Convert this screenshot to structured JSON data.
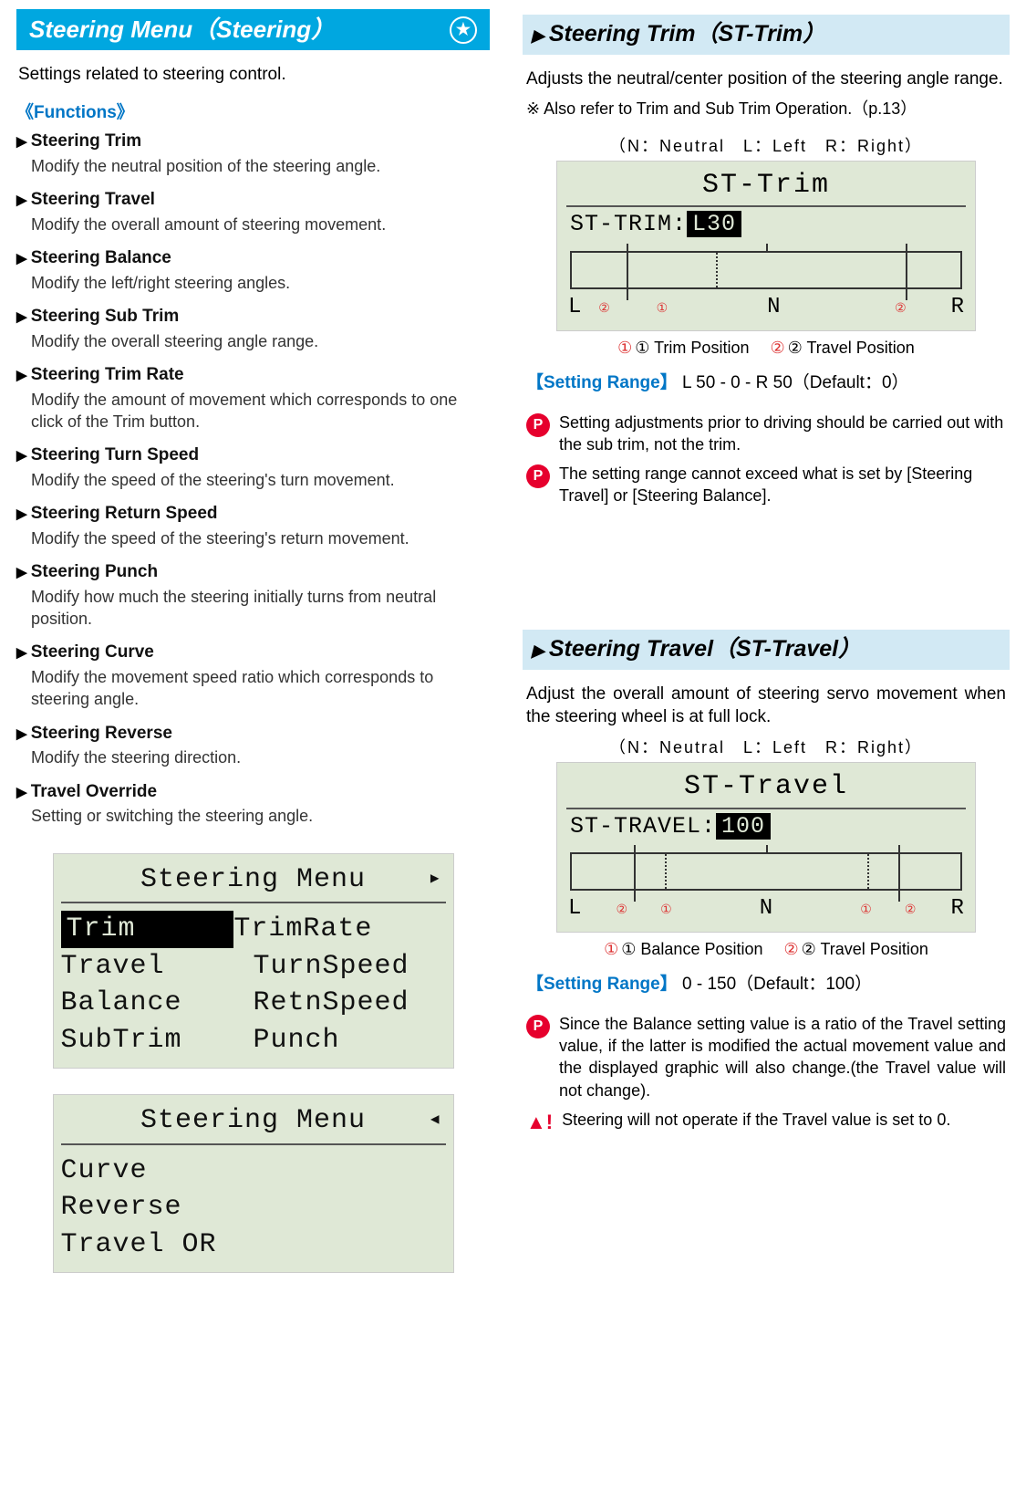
{
  "left": {
    "header": "Steering Menu（Steering）",
    "intro": "Settings related to steering control.",
    "functions_label": "《Functions》",
    "items": [
      {
        "name": "Steering Trim",
        "desc": "Modify the neutral position of the steering angle."
      },
      {
        "name": "Steering Travel",
        "desc": "Modify the overall amount of steering movement."
      },
      {
        "name": "Steering Balance",
        "desc": "Modify the left/right steering angles."
      },
      {
        "name": "Steering Sub Trim",
        "desc": "Modify the overall steering angle range."
      },
      {
        "name": "Steering Trim Rate",
        "desc": "Modify the amount of movement which corresponds to one click of the Trim button."
      },
      {
        "name": "Steering Turn Speed",
        "desc": "Modify the speed of the steering's turn movement."
      },
      {
        "name": "Steering Return Speed",
        "desc": "Modify the speed of the steering's return movement."
      },
      {
        "name": "Steering Punch",
        "desc": "Modify how much the steering initially turns from neutral position."
      },
      {
        "name": "Steering Curve",
        "desc": "Modify the movement speed ratio which corresponds to steering angle."
      },
      {
        "name": "Steering Reverse",
        "desc": "Modify the steering direction."
      },
      {
        "name": "Travel Override",
        "desc": "Setting or switching the steering angle."
      }
    ],
    "lcd1": {
      "title": "Steering Menu",
      "arrow": "▶",
      "rows": [
        [
          "Trim",
          "TrimRate"
        ],
        [
          "Travel",
          "TurnSpeed"
        ],
        [
          "Balance",
          "RetnSpeed"
        ],
        [
          "SubTrim",
          "Punch"
        ]
      ],
      "selected": "Trim"
    },
    "lcd2": {
      "title": "Steering Menu",
      "arrow": "◀",
      "rows": [
        [
          "Curve",
          ""
        ],
        [
          "Reverse",
          ""
        ],
        [
          "Travel OR",
          ""
        ]
      ]
    }
  },
  "right": {
    "trim": {
      "header": "Steering Trim（ST-Trim）",
      "desc": "Adjusts the neutral/center position of the steering angle range.",
      "note": "※ Also refer to Trim and Sub Trim Operation.（p.13）",
      "legend": "（N：Neutral　L：Left　R：Right）",
      "lcd_title": "ST-Trim",
      "lcd_label": "ST-TRIM:",
      "lcd_value": "L30",
      "ann1": "① Trim Position",
      "ann2": "② Travel Position",
      "L": "L",
      "N": "N",
      "R": "R",
      "setting_label": "【Setting Range】",
      "setting_val": "L 50 - 0 - R 50（Default：0）",
      "p1": "Setting adjustments prior to driving should be carried out with the sub trim, not the trim.",
      "p2": "The setting range cannot exceed what is set by [Steering Travel] or [Steering Balance]."
    },
    "travel": {
      "header": "Steering Travel（ST-Travel）",
      "desc": "Adjust the overall amount of steering servo movement when the steering wheel is at full lock.",
      "legend": "（N：Neutral　L：Left　R：Right）",
      "lcd_title": "ST-Travel",
      "lcd_label": "ST-TRAVEL:",
      "lcd_value": "100",
      "ann1": "① Balance Position",
      "ann2": "② Travel Position",
      "L": "L",
      "N": "N",
      "R": "R",
      "setting_label": "【Setting Range】",
      "setting_val": "0 - 150（Default：100）",
      "p1": "Since the Balance setting value is a ratio of the Travel setting value, if the latter is modified the actual movement value and the displayed graphic will also change.(the Travel value will not change).",
      "warn": "Steering will not operate if the Travel value is set to 0."
    }
  }
}
